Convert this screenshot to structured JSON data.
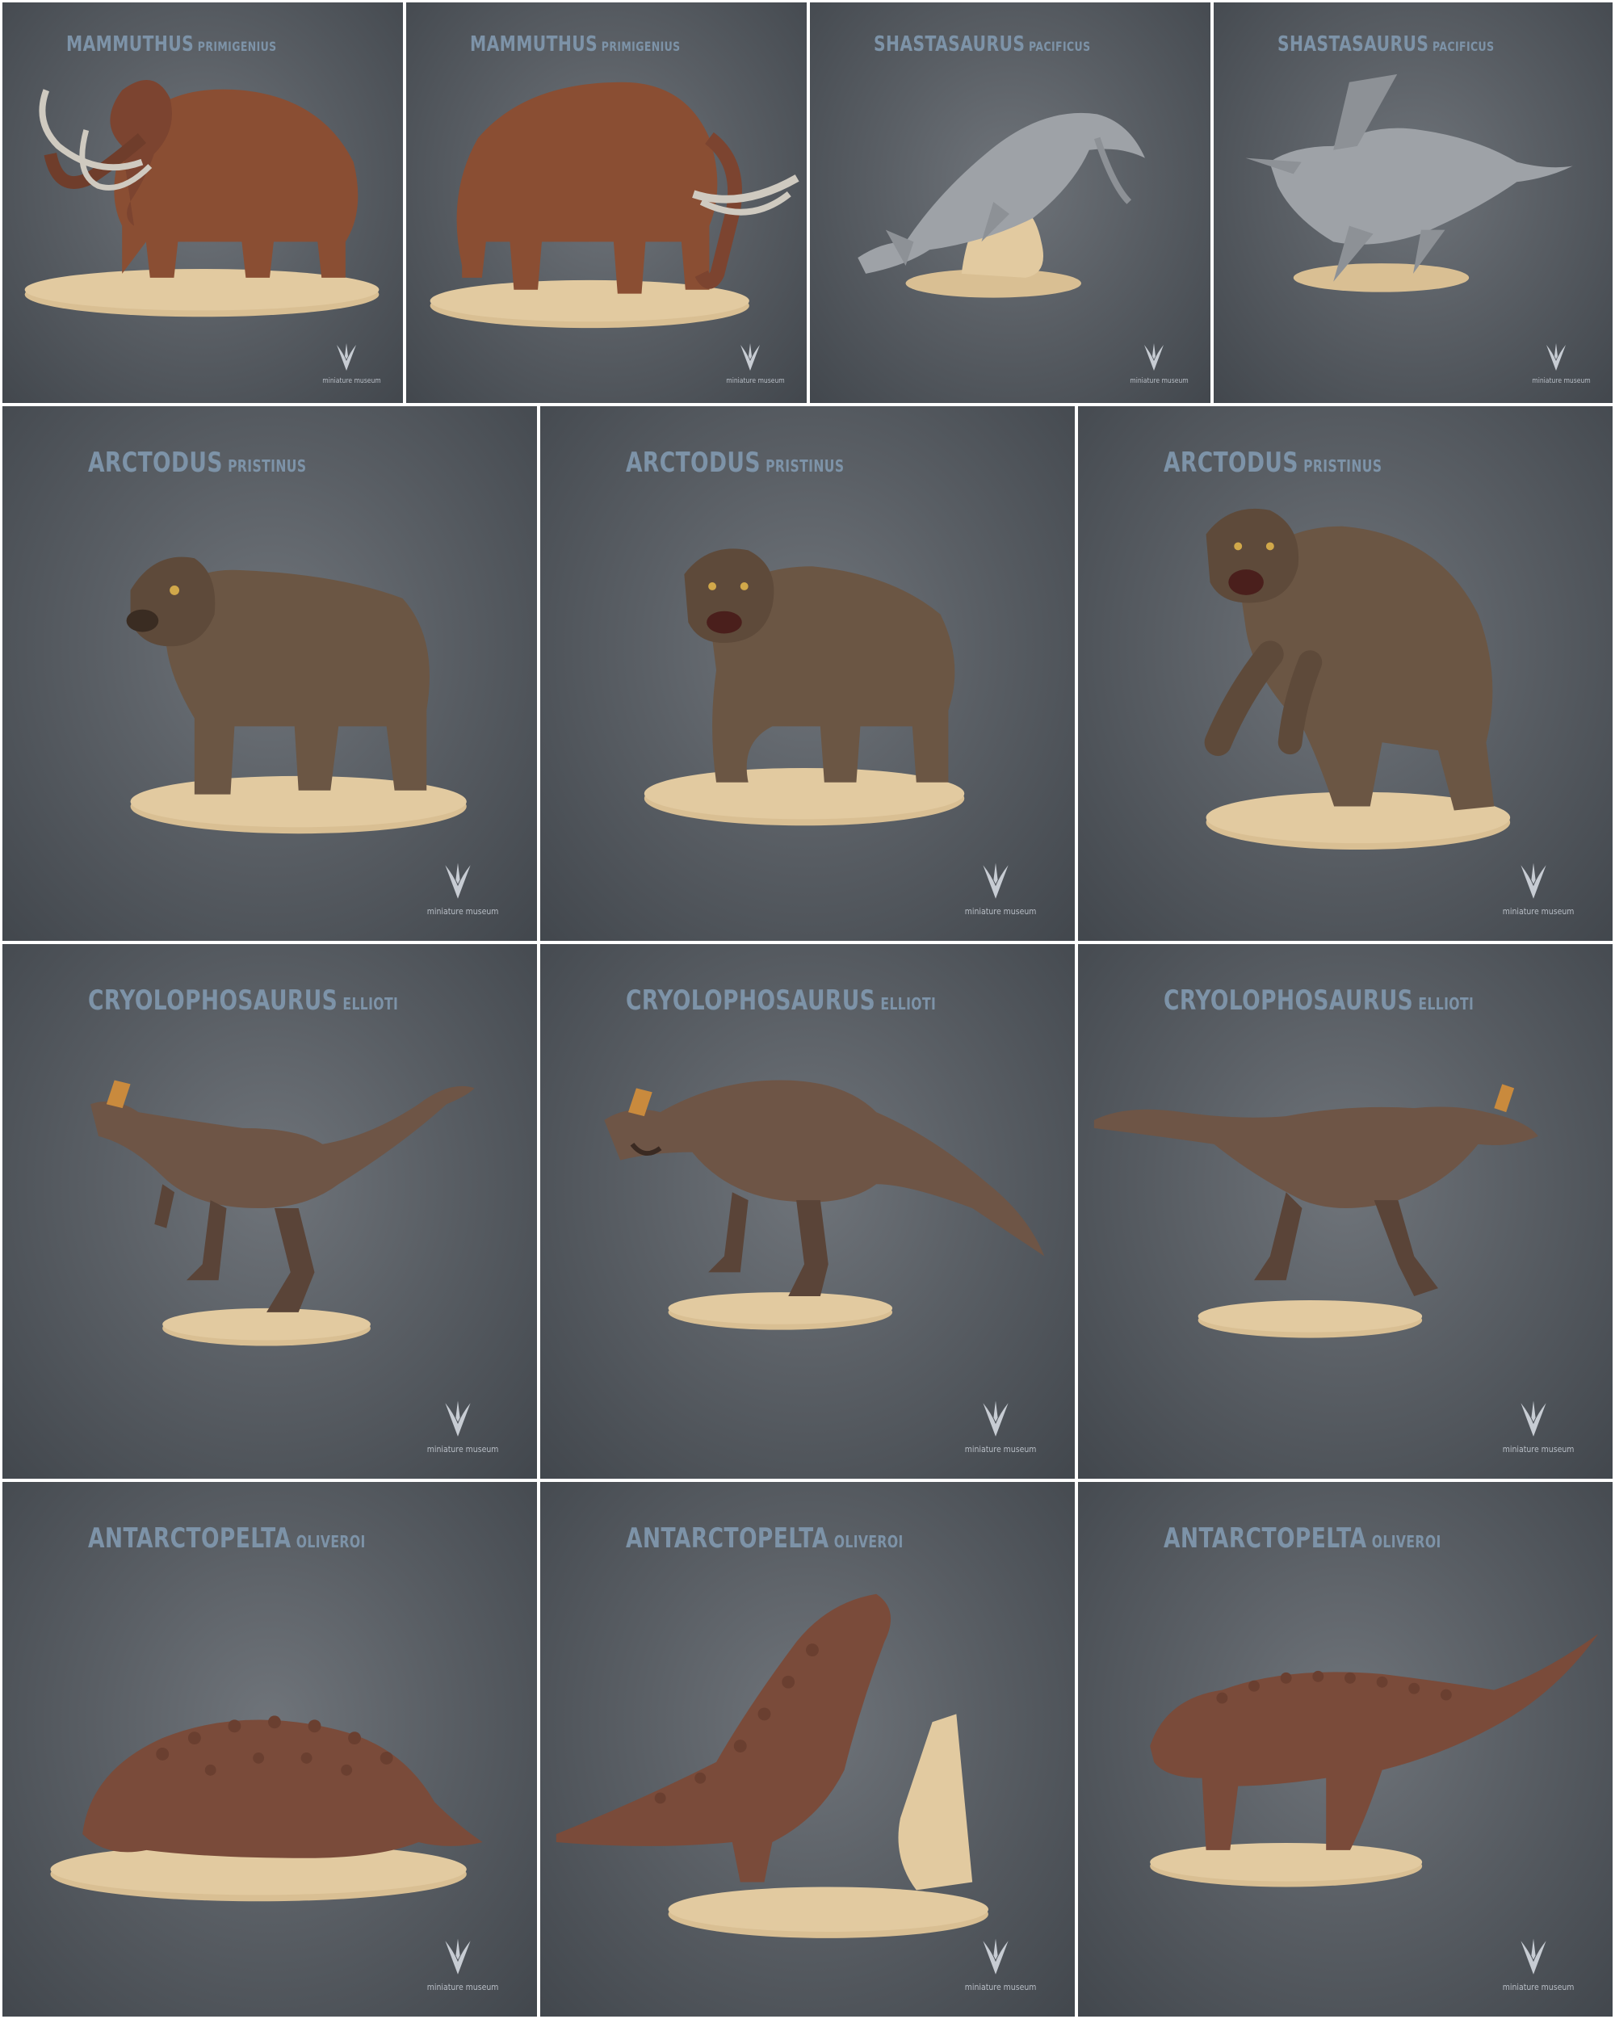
{
  "brand": "miniature museum",
  "palette": {
    "background": "#5a5f65",
    "title": "#7d93a8",
    "base": "#d9bf93",
    "mammoth": "#8a4e33",
    "ichthyosaur": "#9ea2a7",
    "bear": "#6b5644",
    "theropod": "#6e5546",
    "ankylosaur": "#7a4b3a"
  },
  "tiles": [
    {
      "genus": "MAMMUTHUS",
      "species": "PRIMIGENIUS",
      "figure": "mammoth-icon"
    },
    {
      "genus": "MAMMUTHUS",
      "species": "PRIMIGENIUS",
      "figure": "mammoth-icon"
    },
    {
      "genus": "SHASTASAURUS",
      "species": "PACIFICUS",
      "figure": "ichthyosaur-icon"
    },
    {
      "genus": "SHASTASAURUS",
      "species": "PACIFICUS",
      "figure": "ichthyosaur-icon"
    },
    {
      "genus": "ARCTODUS",
      "species": "PRISTINUS",
      "figure": "bear-icon"
    },
    {
      "genus": "ARCTODUS",
      "species": "PRISTINUS",
      "figure": "bear-icon"
    },
    {
      "genus": "ARCTODUS",
      "species": "PRISTINUS",
      "figure": "bear-icon"
    },
    {
      "genus": "CRYOLOPHOSAURUS",
      "species": "ELLIOTI",
      "figure": "theropod-icon"
    },
    {
      "genus": "CRYOLOPHOSAURUS",
      "species": "ELLIOTI",
      "figure": "theropod-icon"
    },
    {
      "genus": "CRYOLOPHOSAURUS",
      "species": "ELLIOTI",
      "figure": "theropod-icon"
    },
    {
      "genus": "ANTARCTOPELTA",
      "species": "OLIVEROI",
      "figure": "ankylosaur-icon"
    },
    {
      "genus": "ANTARCTOPELTA",
      "species": "OLIVEROI",
      "figure": "ankylosaur-icon"
    },
    {
      "genus": "ANTARCTOPELTA",
      "species": "OLIVEROI",
      "figure": "ankylosaur-icon"
    }
  ]
}
